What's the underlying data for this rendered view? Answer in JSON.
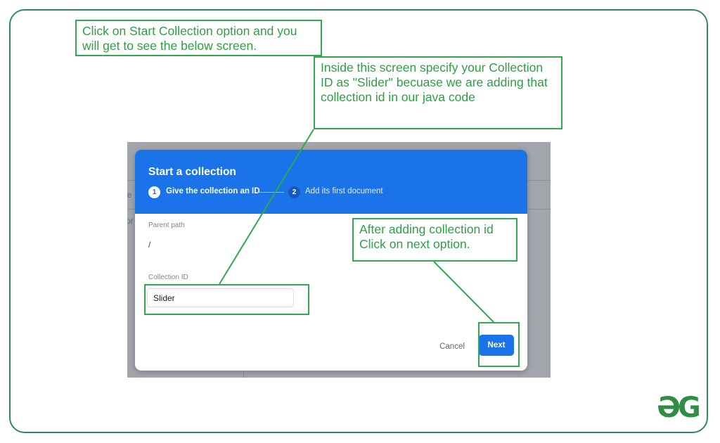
{
  "callouts": {
    "start": "Click on Start Collection option and you will get to see the below screen.",
    "collection_id": "Inside this screen specify your Collection ID as \"Slider\" becuase we are adding that collection id in our java code",
    "next": "After adding collection id Click on next option."
  },
  "dialog": {
    "title": "Start a collection",
    "step1_number": "1",
    "step1_label": "Give the collection an ID",
    "step2_number": "2",
    "step2_label": "Add its first document",
    "parent_path_label": "Parent path",
    "parent_path_value": "/",
    "collection_id_label": "Collection ID",
    "collection_id_value": "Slider",
    "cancel_label": "Cancel",
    "next_label": "Next"
  },
  "background": {
    "left_fragment_1": "e",
    "left_fragment_2": "or"
  },
  "logo": {
    "text": "ƏG",
    "color": "#2f8d46"
  },
  "colors": {
    "callout": "#2fa84f",
    "accent": "#1a73e8",
    "frame": "#2e8b57"
  }
}
